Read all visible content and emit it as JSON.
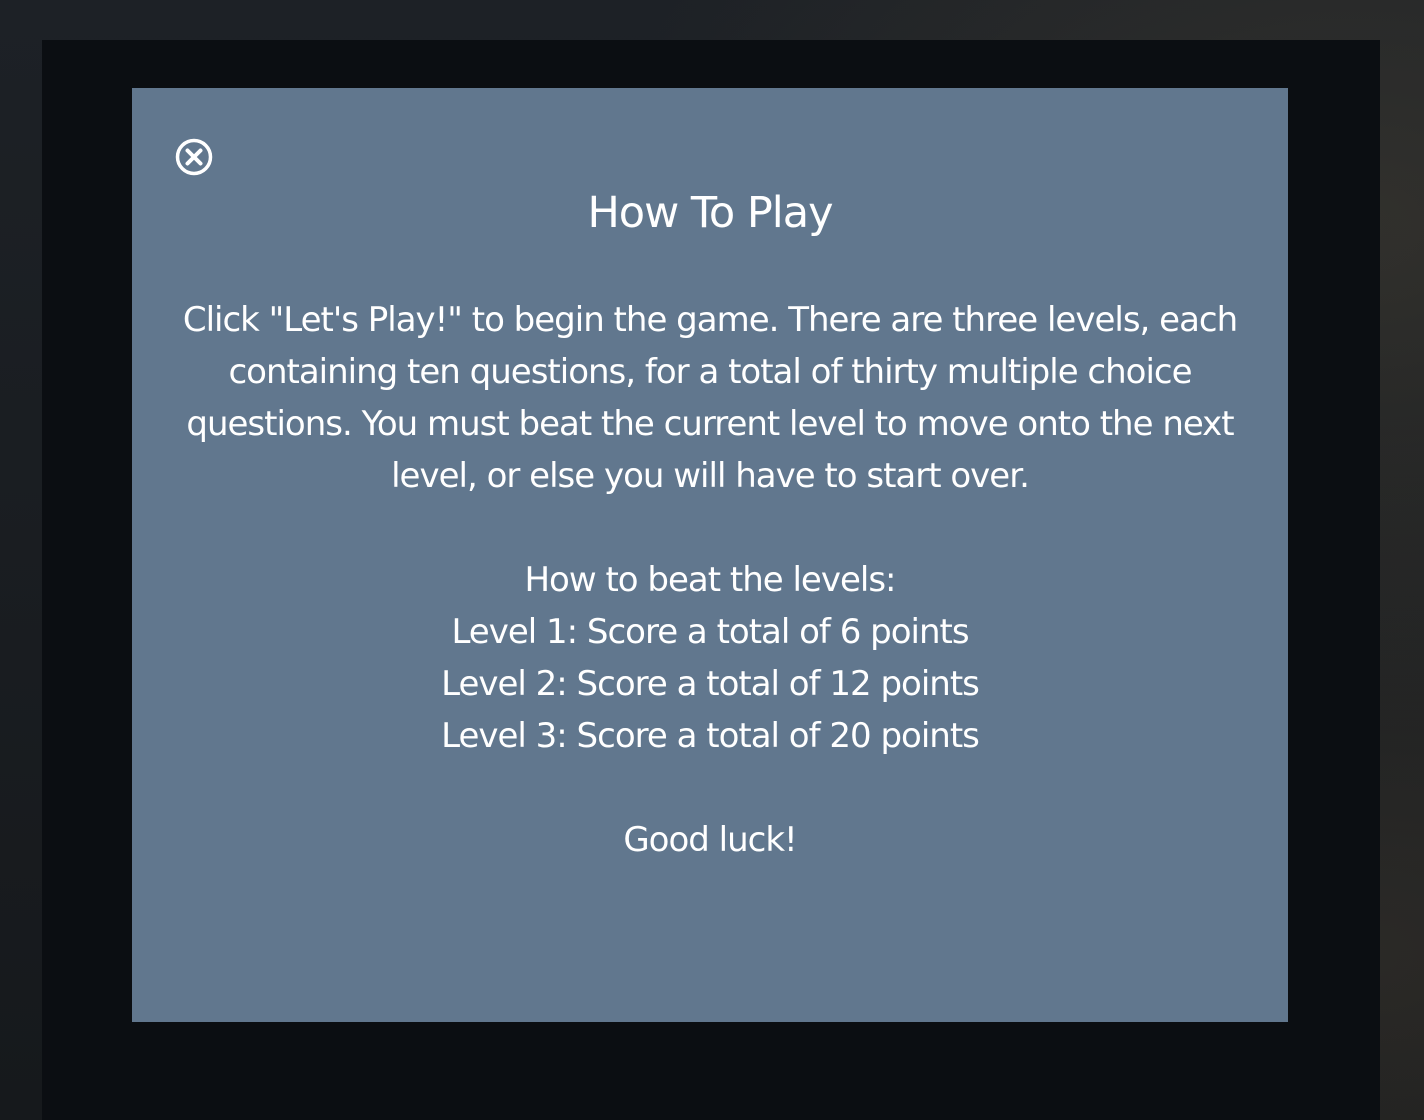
{
  "modal": {
    "title": "How To Play",
    "intro": "Click \"Let's Play!\" to begin the game. There are three levels, each containing ten questions, for a total of thirty multiple choice questions. You must beat the current level to move onto the next level, or else you will have to start over.",
    "levels_heading": "How to beat the levels:",
    "levels": [
      "Level 1: Score a total of 6 points",
      "Level 2: Score a total of 12 points",
      "Level 3: Score a total of 20 points"
    ],
    "closing": "Good luck!",
    "close_icon": "close-circle-x"
  },
  "colors": {
    "modal_bg": "#61778e",
    "overlay_bg": "#0b0e12",
    "text": "#ffffff"
  }
}
